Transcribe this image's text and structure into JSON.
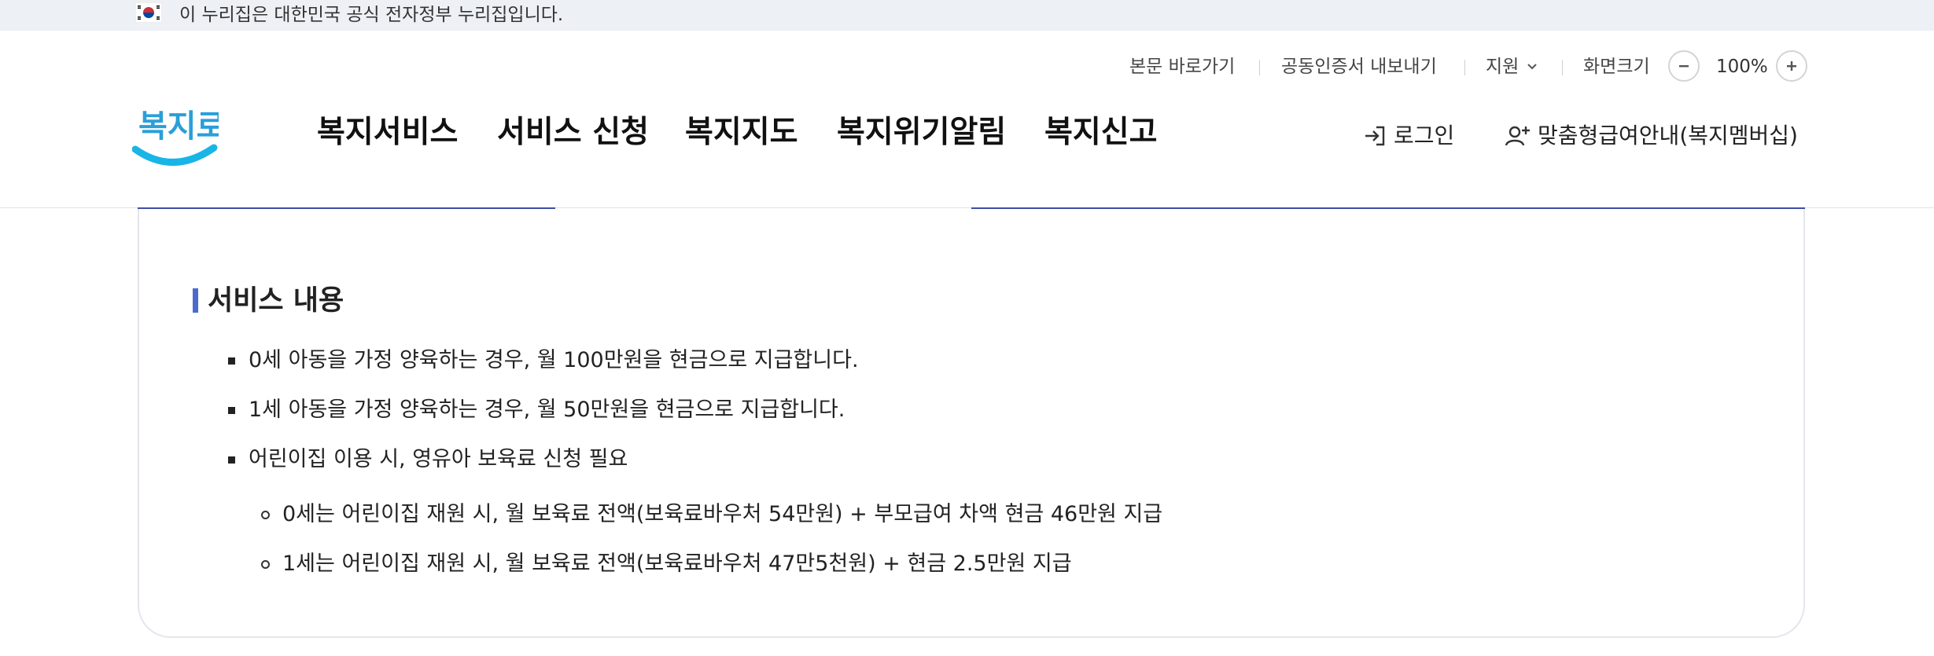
{
  "gov_banner": {
    "text": "이 누리집은 대한민국 공식 전자정부 누리집입니다."
  },
  "util_menu": {
    "skip_to_content": "본문 바로가기",
    "export_certificate": "공동인증서 내보내기",
    "support": "지원",
    "screen_size": "화면크기",
    "zoom_value": "100%"
  },
  "logo": {
    "text": "복지로"
  },
  "nav": {
    "items": [
      "복지서비스",
      "서비스 신청",
      "복지지도",
      "복지위기알림",
      "복지신고"
    ]
  },
  "header_links": {
    "login": "로그인",
    "membership": "맞춤형급여안내(복지멤버십)"
  },
  "colors": {
    "accent": "#4a6ad0",
    "tab_underline": "#3b4ea8",
    "logo_blue": "#2a9fd8"
  },
  "service": {
    "title": "서비스 내용",
    "items": [
      "0세 아동을 가정 양육하는 경우, 월 100만원을 현금으로 지급합니다.",
      "1세 아동을 가정 양육하는 경우, 월 50만원을 현금으로 지급합니다.",
      "어린이집 이용 시, 영유아 보육료 신청 필요"
    ],
    "sub_items": [
      "0세는 어린이집 재원 시, 월 보육료 전액(보육료바우처 54만원) + 부모급여 차액 현금 46만원 지급",
      "1세는 어린이집 재원 시, 월 보육료 전액(보육료바우처 47만5천원) + 현금 2.5만원 지급"
    ]
  }
}
